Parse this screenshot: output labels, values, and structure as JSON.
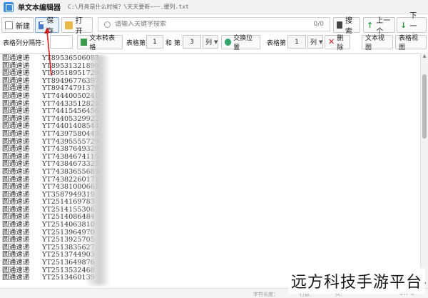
{
  "window": {
    "title": "单文本编辑器",
    "path": "C:\\月亮是什么时候？\\天天要新~~~.缓列.txt"
  },
  "toolbar": {
    "new_label": "新建",
    "save_label": "保存",
    "open_label": "打开",
    "search_placeholder": "请输入关键字搜索",
    "search_count": "0/0",
    "search_label": "搜索",
    "prev_label": "上一个",
    "next_label": "下一个"
  },
  "table_toolbar": {
    "separator_label": "表格列分隔符：",
    "text_to_table_label": "文本转表格",
    "table_col_label": "表格第",
    "col_a_value": "1",
    "and_label": "和 第",
    "col_b_value": "3",
    "col_unit": "列",
    "swap_label": "交换位置",
    "table_col_label2": "表格第",
    "col_c_value": "1",
    "col_unit2": "列",
    "delete_label": "删除",
    "text_view_label": "文本视图",
    "table_view_label": "表格视图"
  },
  "rows": [
    {
      "name": "圆通速递",
      "code": "YT89536506083"
    },
    {
      "name": "圆通速递",
      "code": "YT89531321899"
    },
    {
      "name": "圆通速递",
      "code": "YT89518951729"
    },
    {
      "name": "圆通速递",
      "code": "YT89496776397"
    },
    {
      "name": "圆通速递",
      "code": "YT89474791378"
    },
    {
      "name": "圆通速递",
      "code": "YT74440050241"
    },
    {
      "name": "圆通速递",
      "code": "YT74433512829"
    },
    {
      "name": "圆通速递",
      "code": "YT74415456456"
    },
    {
      "name": "圆通速递",
      "code": "YT74405329922"
    },
    {
      "name": "圆通速递",
      "code": "YT74401408544"
    },
    {
      "name": "圆通速递",
      "code": "YT74397580443"
    },
    {
      "name": "圆通速递",
      "code": "YT74395555729"
    },
    {
      "name": "圆通速递",
      "code": "YT74387649320"
    },
    {
      "name": "圆通速递",
      "code": "YT74384674115"
    },
    {
      "name": "圆通速递",
      "code": "YT74384673325"
    },
    {
      "name": "圆通速递",
      "code": "YT74383655689"
    },
    {
      "name": "圆通速递",
      "code": "YT74382260171"
    },
    {
      "name": "圆通速递",
      "code": "YT74381000661"
    },
    {
      "name": "圆通速递",
      "code": "YT3587949319"
    },
    {
      "name": "圆通速递",
      "code": "YT2514169783"
    },
    {
      "name": "圆通速递",
      "code": "YT2514155306"
    },
    {
      "name": "圆通速递",
      "code": "YT2514086484"
    },
    {
      "name": "圆通速递",
      "code": "YT2514063810"
    },
    {
      "name": "圆通速递",
      "code": "YT2513964970"
    },
    {
      "name": "圆通速递",
      "code": "YT2513925705"
    },
    {
      "name": "圆通速递",
      "code": "YT2513835627"
    },
    {
      "name": "圆通速递",
      "code": "YT2513744903"
    },
    {
      "name": "圆通速递",
      "code": "YT2513649876"
    },
    {
      "name": "圆通速递",
      "code": "YT2513532468"
    },
    {
      "name": "圆通速递",
      "code": "YT2513460139"
    }
  ],
  "status": {
    "char_label": "字符长度：",
    "row_label": "行数：",
    "col_label": "列：",
    "encoding": "UTF-8"
  },
  "watermark": "远方科技手游平台",
  "colors": {
    "accent_red": "#d02020",
    "green": "#2a9a3a",
    "blue": "#3c8edc"
  }
}
